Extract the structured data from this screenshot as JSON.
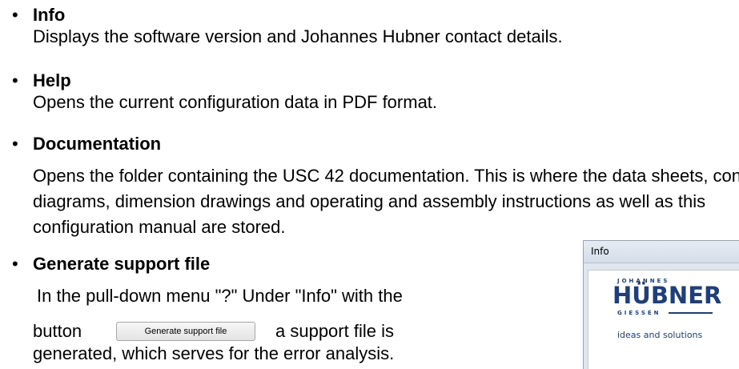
{
  "items": [
    {
      "title": "Info",
      "lines": [
        "Displays the software version and Johannes Hubner contact details."
      ]
    },
    {
      "title": "Help",
      "lines": [
        "Opens the current configuration data in PDF format."
      ]
    },
    {
      "title": "Documentation",
      "lines": [
        "Opens the folder containing the USC 42 documentation. This is where the data sheets, connection",
        "diagrams, dimension drawings and operating and assembly instructions as well as this",
        "configuration manual are stored."
      ]
    },
    {
      "title": "Generate support file",
      "lines": [
        "In the pull-down menu \"?\" Under \"Info\" with the",
        "button",
        "a support file is",
        "generated, which serves for the error analysis."
      ]
    }
  ],
  "bullet_symbol": "•",
  "inline_button_label": "Generate support file",
  "info_window": {
    "title": "Info",
    "logo_top": "JOHANNES",
    "logo_main": "HÜBNER",
    "logo_bottom": "GIESSEN",
    "tagline": "ideas and solutions",
    "brand_color": "#1f3f7a"
  }
}
